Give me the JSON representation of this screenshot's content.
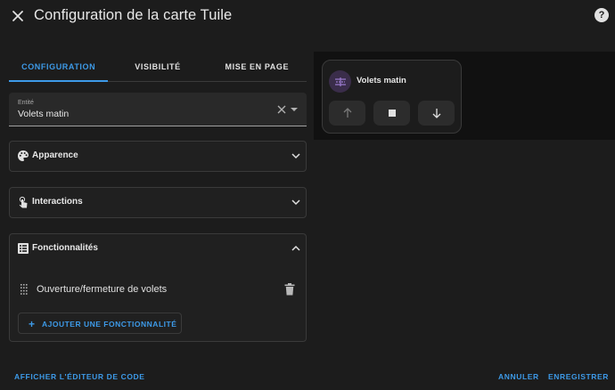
{
  "dialog": {
    "title": "Configuration de la carte Tuile",
    "help": "?"
  },
  "tabs": [
    {
      "label": "CONFIGURATION",
      "active": true
    },
    {
      "label": "VISIBILITÉ",
      "active": false
    },
    {
      "label": "MISE EN PAGE",
      "active": false
    }
  ],
  "entity": {
    "label": "Entité",
    "value": "Volets matin"
  },
  "panels": {
    "appearance": {
      "title": "Apparence",
      "icon": "palette-icon",
      "expanded": false
    },
    "interactions": {
      "title": "Interactions",
      "icon": "gesture-tap-icon",
      "expanded": false
    },
    "features": {
      "title": "Fonctionnalités",
      "icon": "list-box-icon",
      "expanded": true,
      "items": [
        {
          "label": "Ouverture/fermeture de volets"
        }
      ],
      "add_label": "AJOUTER UNE FONCTIONNALITÉ",
      "add_icon": "+"
    }
  },
  "preview": {
    "name": "Volets matin",
    "icon": "window-shutter-icon",
    "icon_color": "#9c7bd0",
    "buttons": [
      "arrow-up-icon",
      "stop-icon",
      "arrow-down-icon"
    ]
  },
  "footer": {
    "code_editor": "AFFICHER L'ÉDITEUR DE CODE",
    "cancel": "ANNULER",
    "save": "ENREGISTRER"
  },
  "colors": {
    "accent": "#3d9ae8",
    "background": "#1c1c1c",
    "panel": "#202020"
  }
}
